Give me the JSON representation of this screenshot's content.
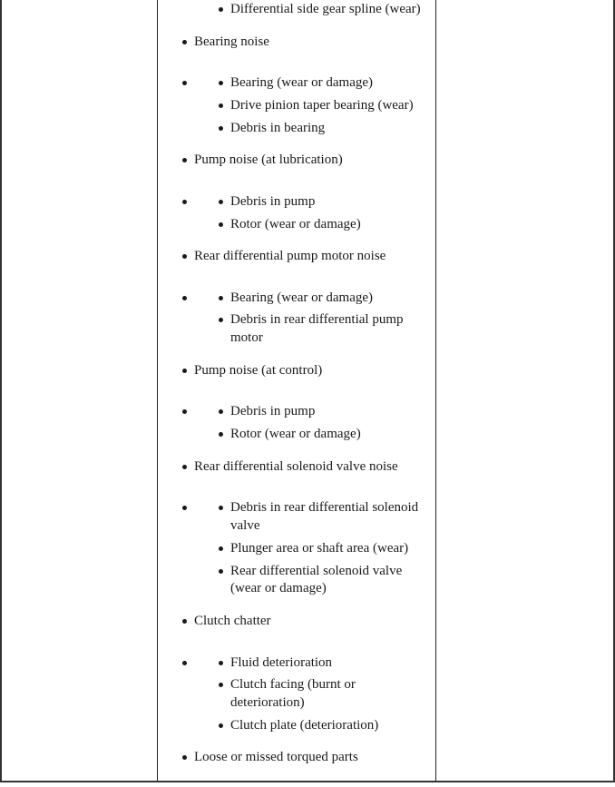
{
  "rows": [
    {
      "level": 2,
      "text": "Differential side gear spline (wear)"
    },
    {
      "level": 1,
      "text": "Bearing noise"
    },
    {
      "level": "1b",
      "text": ""
    },
    {
      "level": 2,
      "text": "Bearing (wear or damage)"
    },
    {
      "level": 2,
      "text": "Drive pinion taper bearing (wear)"
    },
    {
      "level": 2,
      "text": "Debris in bearing"
    },
    {
      "level": 1,
      "text": "Pump noise (at lubrication)"
    },
    {
      "level": 2,
      "text": "Debris in pump"
    },
    {
      "level": 2,
      "text": "Rotor (wear or damage)"
    },
    {
      "level": 1,
      "text": "Rear differential pump motor noise"
    },
    {
      "level": 2,
      "text": "Bearing (wear or damage)"
    },
    {
      "level": 2,
      "text": "Debris in rear differential pump"
    },
    {
      "level": 3,
      "text": "motor"
    },
    {
      "level": 1,
      "text": "Pump noise (at control)"
    },
    {
      "level": 2,
      "text": "Debris in pump"
    },
    {
      "level": 2,
      "text": "Rotor (wear or damage)"
    },
    {
      "level": 1,
      "text": "Rear differential solenoid valve noise"
    },
    {
      "level": 2,
      "text": "Debris in rear differential solenoid"
    },
    {
      "level": 3,
      "text": "valve"
    },
    {
      "level": 2,
      "text": "Plunger area or shaft area (wear)"
    },
    {
      "level": 2,
      "text": "Rear differential solenoid valve"
    },
    {
      "level": 3,
      "text": "(wear or damage)"
    },
    {
      "level": 1,
      "text": "Clutch chatter"
    },
    {
      "level": 2,
      "text": "Fluid deterioration"
    },
    {
      "level": 2,
      "text": "Clutch facing (burnt or"
    },
    {
      "level": 3,
      "text": "deterioration)"
    },
    {
      "level": 2,
      "text": "Clutch plate (deterioration)"
    },
    {
      "level": 1,
      "text": "Loose or missed torqued parts"
    }
  ]
}
